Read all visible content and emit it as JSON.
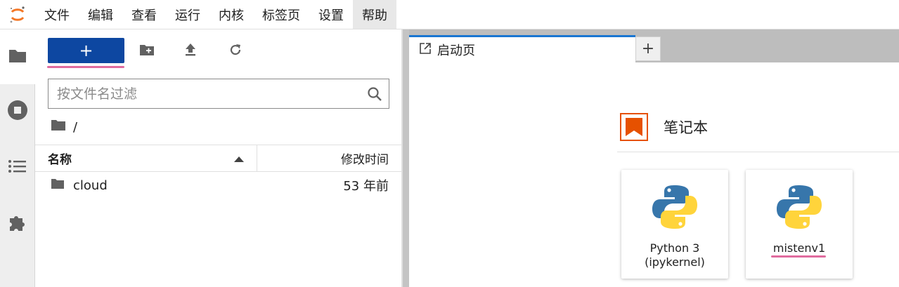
{
  "menubar": {
    "items": [
      "文件",
      "编辑",
      "查看",
      "运行",
      "内核",
      "标签页",
      "设置",
      "帮助"
    ],
    "active_index": 7
  },
  "sidebar": {
    "buttons": [
      "folder-icon",
      "stop-circle-icon",
      "list-icon",
      "puzzle-icon"
    ]
  },
  "filebrowser": {
    "new_label": "+",
    "filter_placeholder": "按文件名过滤",
    "breadcrumb": "/",
    "columns": {
      "name": "名称",
      "modified": "修改时间"
    },
    "rows": [
      {
        "name": "cloud",
        "modified": "53 年前",
        "type": "folder"
      }
    ]
  },
  "main": {
    "tab_label": "启动页",
    "tab_add": "+",
    "section_title": "笔记本",
    "kernels": [
      {
        "label_line1": "Python 3",
        "label_line2": "(ipykernel)"
      },
      {
        "label_line1": "mistenv1",
        "label_line2": ""
      }
    ]
  },
  "colors": {
    "accent": "#0d47a1",
    "tab_accent": "#1976d2",
    "notebook_icon": "#e65100",
    "highlight_underline": "#e06c9f"
  }
}
